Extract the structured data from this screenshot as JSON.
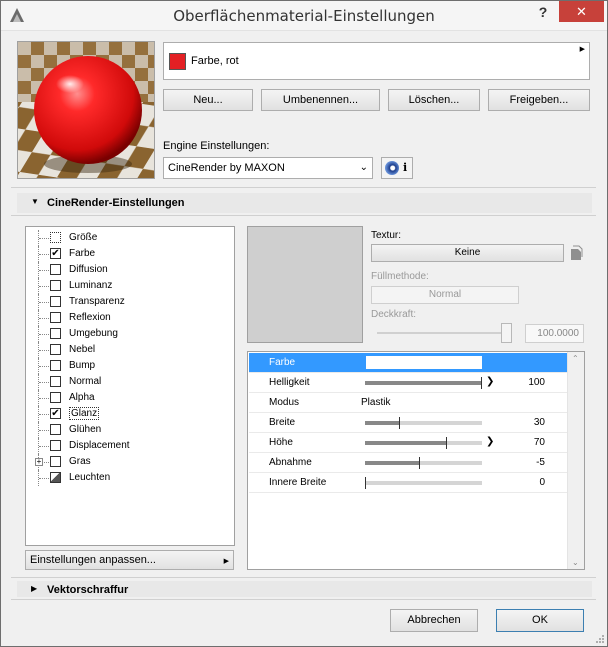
{
  "window": {
    "title": "Oberflächenmaterial-Einstellungen",
    "help": "?",
    "close": "✕"
  },
  "material": {
    "name": "Farbe, rot",
    "swatch_color": "#e32024"
  },
  "buttons": {
    "new": "Neu...",
    "rename": "Umbenennen...",
    "delete": "Löschen...",
    "share": "Freigeben..."
  },
  "engine": {
    "label": "Engine Einstellungen:",
    "selected": "CineRender by MAXON",
    "info": "i"
  },
  "sections": {
    "cinerender": "CineRender-Einstellungen",
    "vektor": "Vektorschraffur"
  },
  "channels": [
    {
      "label": "Größe",
      "checked": false
    },
    {
      "label": "Farbe",
      "checked": true
    },
    {
      "label": "Diffusion",
      "checked": false
    },
    {
      "label": "Luminanz",
      "checked": false
    },
    {
      "label": "Transparenz",
      "checked": false
    },
    {
      "label": "Reflexion",
      "checked": false
    },
    {
      "label": "Umgebung",
      "checked": false
    },
    {
      "label": "Nebel",
      "checked": false
    },
    {
      "label": "Bump",
      "checked": false
    },
    {
      "label": "Normal",
      "checked": false
    },
    {
      "label": "Alpha",
      "checked": false
    },
    {
      "label": "Glanz",
      "checked": true
    },
    {
      "label": "Glühen",
      "checked": false
    },
    {
      "label": "Displacement",
      "checked": false
    },
    {
      "label": "Gras",
      "checked": false
    },
    {
      "label": "Leuchten",
      "checked": false
    }
  ],
  "settings_button": "Einstellungen anpassen...",
  "texture": {
    "label": "Textur:",
    "button": "Keine",
    "fill_label": "Füllmethode:",
    "fill_value": "Normal",
    "opacity_label": "Deckkraft:",
    "opacity_value": "100.0000",
    "opacity_fraction": 1.0
  },
  "properties": [
    {
      "name": "Farbe",
      "type": "color",
      "value": ""
    },
    {
      "name": "Helligkeit",
      "type": "slider",
      "fraction": 1.0,
      "overflow": true,
      "value": "100"
    },
    {
      "name": "Modus",
      "type": "text",
      "text": "Plastik",
      "value": ""
    },
    {
      "name": "Breite",
      "type": "slider",
      "fraction": 0.3,
      "overflow": false,
      "value": "30"
    },
    {
      "name": "Höhe",
      "type": "slider",
      "fraction": 0.7,
      "overflow": true,
      "value": "70"
    },
    {
      "name": "Abnahme",
      "type": "slider",
      "fraction": 0.47,
      "overflow": false,
      "value": "-5"
    },
    {
      "name": "Innere Breite",
      "type": "slider",
      "fraction": 0.0,
      "overflow": false,
      "value": "0"
    }
  ],
  "footer": {
    "cancel": "Abbrechen",
    "ok": "OK"
  }
}
